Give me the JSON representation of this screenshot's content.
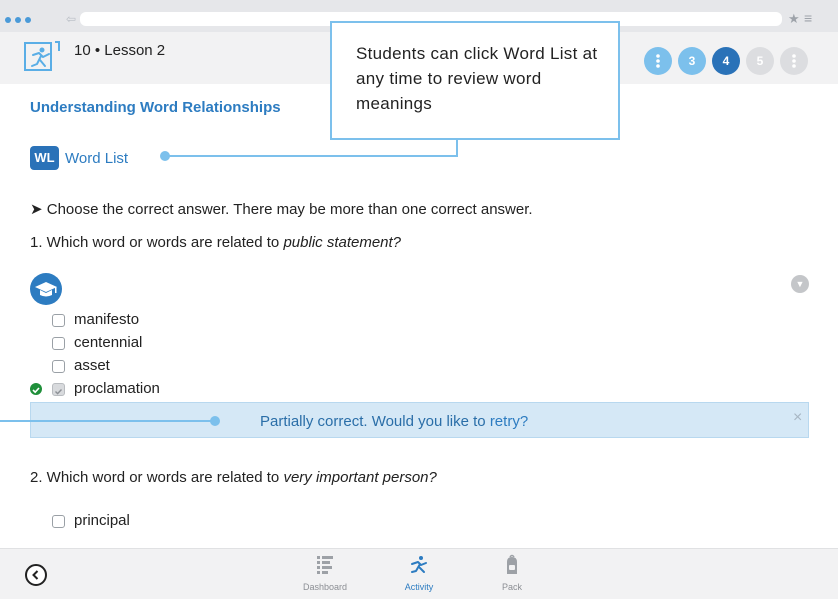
{
  "header": {
    "lesson": "10 • Lesson 2",
    "steps": [
      {
        "label": "",
        "state": "info"
      },
      {
        "label": "3",
        "state": "light"
      },
      {
        "label": "4",
        "state": "active"
      },
      {
        "label": "5",
        "state": "inactive"
      },
      {
        "label": "",
        "state": "info-inactive"
      }
    ]
  },
  "callout": {
    "text": "Students can click Word List at any time to review word meanings"
  },
  "page": {
    "title": "Understanding Word Relationships",
    "word_list_badge": "WL",
    "word_list_label": "Word List",
    "instruction": "Choose the correct answer. There may be more than one correct answer."
  },
  "question1": {
    "prefix": "1. Which word or words are related to ",
    "term": "public statement?",
    "options": [
      {
        "label": "manifesto",
        "checked": false
      },
      {
        "label": "centennial",
        "checked": false
      },
      {
        "label": "asset",
        "checked": false
      },
      {
        "label": "proclamation",
        "checked": true
      }
    ],
    "feedback_text": "Partially correct. Would you like to ",
    "feedback_link": "retry?"
  },
  "question2": {
    "prefix": "2. Which word or words are related to ",
    "term": "very important person?",
    "options": [
      {
        "label": "principal",
        "checked": false
      }
    ]
  },
  "bottom_nav": {
    "items": [
      {
        "label": "Dashboard",
        "icon": "dashboard-icon",
        "active": false
      },
      {
        "label": "Activity",
        "icon": "activity-icon",
        "active": true
      },
      {
        "label": "Pack",
        "icon": "pack-icon",
        "active": false
      }
    ]
  },
  "colors": {
    "accent": "#2d7cc1",
    "callout_border": "#7cc0ec",
    "feedback_bg": "#d5e8f6",
    "correct": "#1f8f3a"
  }
}
